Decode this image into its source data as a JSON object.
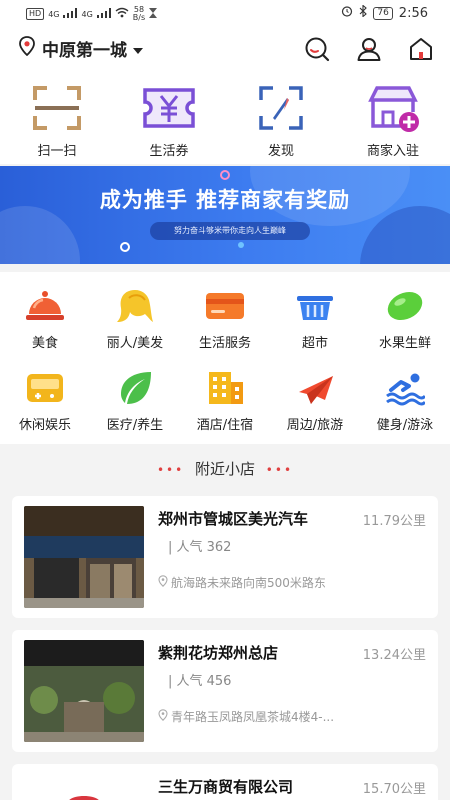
{
  "status_bar": {
    "chip": "HD",
    "net1": "4G",
    "net2": "4G",
    "speed_value": "58",
    "speed_unit": "B/s",
    "battery": "76",
    "time": "2:56"
  },
  "header": {
    "city": "中原第一城",
    "icons": [
      "location-pin-icon",
      "search-icon",
      "user-icon",
      "home-icon"
    ]
  },
  "quick_actions": [
    {
      "label": "扫一扫",
      "icon": "scan-icon"
    },
    {
      "label": "生活券",
      "icon": "ticket-icon"
    },
    {
      "label": "发现",
      "icon": "compass-icon"
    },
    {
      "label": "商家入驻",
      "icon": "shop-join-icon"
    }
  ],
  "banner": {
    "title": "成为推手 推荐商家有奖励",
    "subtitle": "努力奋斗够米带你走向人生巅峰"
  },
  "categories": [
    {
      "label": "美食",
      "icon": "food-cloche-icon"
    },
    {
      "label": "丽人/美发",
      "icon": "hair-icon"
    },
    {
      "label": "生活服务",
      "icon": "card-icon"
    },
    {
      "label": "超市",
      "icon": "basket-icon"
    },
    {
      "label": "水果生鲜",
      "icon": "lemon-icon"
    },
    {
      "label": "休闲娱乐",
      "icon": "gamepad-icon"
    },
    {
      "label": "医疗/养生",
      "icon": "leaf-icon"
    },
    {
      "label": "酒店/住宿",
      "icon": "building-icon"
    },
    {
      "label": "周边/旅游",
      "icon": "airplane-icon"
    },
    {
      "label": "健身/游泳",
      "icon": "swim-icon"
    }
  ],
  "nearby": {
    "title": "附近小店",
    "shops": [
      {
        "name": "郑州市管城区美光汽车",
        "distance": "11.79公里",
        "popularity": "| 人气 362",
        "address": "航海路未来路向南500米路东"
      },
      {
        "name": "紫荆花坊郑州总店",
        "distance": "13.24公里",
        "popularity": "| 人气 456",
        "address": "青年路玉凤路凤凰茶城4楼4-..."
      },
      {
        "name": "三生万商贸有限公司",
        "distance": "15.70公里",
        "popularity": "",
        "address": ""
      }
    ]
  },
  "colors": {
    "accent": "#e33b3b",
    "banner_blue": "#3d7cf0",
    "icon_purple": "#7a4fd6"
  }
}
